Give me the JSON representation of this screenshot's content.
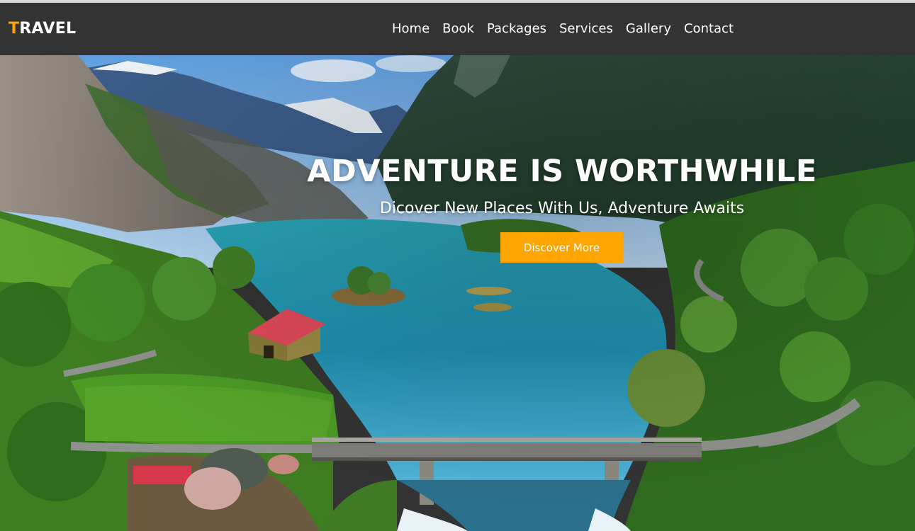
{
  "brand": {
    "first_letter": "T",
    "rest": "RAVEL",
    "accent_color": "#ffa500"
  },
  "nav": {
    "items": [
      {
        "label": "Home"
      },
      {
        "label": "Book"
      },
      {
        "label": "Packages"
      },
      {
        "label": "Services"
      },
      {
        "label": "Gallery"
      },
      {
        "label": "Contact"
      }
    ]
  },
  "hero": {
    "title": "ADVENTURE IS WORTHWHILE",
    "subtitle": "Dicover New Places With Us, Adventure Awaits",
    "cta_label": "Discover More",
    "background": "aerial view of fjord lake with mountains, bridge and red-roofed house"
  }
}
